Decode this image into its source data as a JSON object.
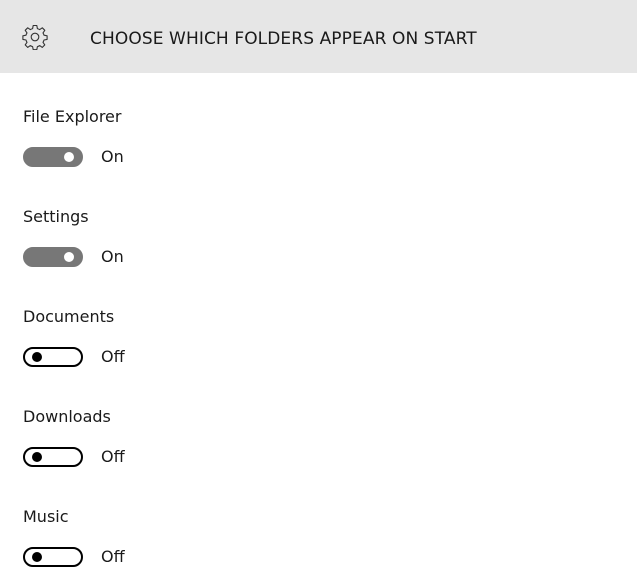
{
  "header": {
    "icon": "gear-icon",
    "title": "CHOOSE WHICH FOLDERS APPEAR ON START"
  },
  "settings": [
    {
      "label": "File Explorer",
      "state": "On",
      "on": true
    },
    {
      "label": "Settings",
      "state": "On",
      "on": true
    },
    {
      "label": "Documents",
      "state": "Off",
      "on": false
    },
    {
      "label": "Downloads",
      "state": "Off",
      "on": false
    },
    {
      "label": "Music",
      "state": "Off",
      "on": false
    }
  ],
  "colors": {
    "header_bg": "#e6e6e6",
    "toggle_on": "#777777",
    "toggle_off_border": "#000000"
  }
}
